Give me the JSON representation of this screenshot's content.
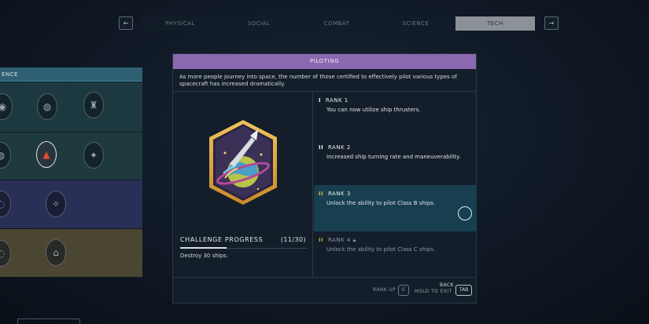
{
  "tabs": {
    "prev_icon": "←",
    "next_icon": "→",
    "items": [
      {
        "label": "PHYSICAL",
        "active": false
      },
      {
        "label": "SOCIAL",
        "active": false
      },
      {
        "label": "COMBAT",
        "active": false
      },
      {
        "label": "SCIENCE",
        "active": false
      },
      {
        "label": "TECH",
        "active": true
      }
    ]
  },
  "left_panel": {
    "header": "ENCE",
    "tier_colors": [
      "#1d3940",
      "#1e3a3e",
      "#2a2f58",
      "#4b4631"
    ]
  },
  "skill": {
    "title": "PILOTING",
    "description": "As more people journey into space, the number of those certified to effectively pilot various types of spacecraft has increased dramatically.",
    "badge_icon": "piloting-badge-icon",
    "challenge": {
      "label": "CHALLENGE PROGRESS",
      "count": "(11/30)",
      "progress": 0.3667,
      "description": "Destroy 30 ships."
    },
    "ranks": [
      {
        "pips": "I",
        "label": "RANK 1",
        "description": "You can now utilize ship thrusters.",
        "selected": false,
        "locked": false
      },
      {
        "pips": "II",
        "label": "RANK 2",
        "description": "Increased ship turning rate and maneuverability.",
        "selected": false,
        "locked": false
      },
      {
        "pips": "II",
        "label": "RANK 3",
        "description": "Unlock the ability to pilot Class B ships.",
        "selected": true,
        "locked": false
      },
      {
        "pips": "II",
        "label": "RANK 4",
        "description": "Unlock the ability to pilot Class C ships.",
        "selected": false,
        "locked": true
      }
    ]
  },
  "footer": {
    "rank_up_label": "RANK UP",
    "rank_up_key": "E",
    "back_label": "BACK",
    "hold_label": "HOLD TO EXIT",
    "back_key": "TAB"
  },
  "colors": {
    "title_bar": "#8b68b0",
    "selected_rank": "#173f4f",
    "accent_gold": "#e7b13a",
    "active_tab": "#8c9197"
  }
}
